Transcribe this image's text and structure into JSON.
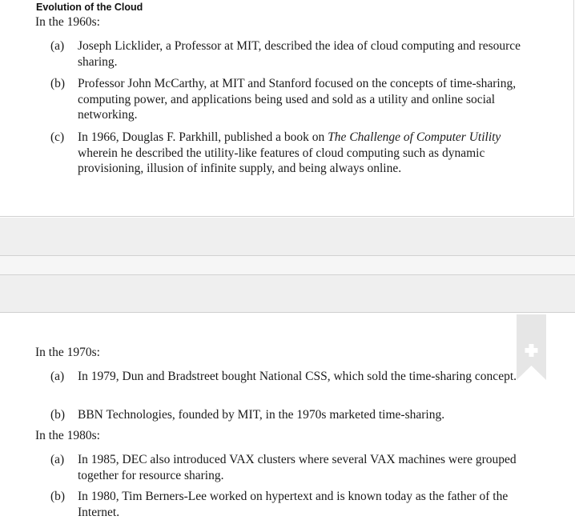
{
  "section_title": "Evolution of the Cloud",
  "era_1960s": {
    "heading": "In the 1960s:",
    "items": [
      {
        "label": "(a)",
        "text": "Joseph Licklider, a Professor at MIT, described the idea of cloud computing and resource sharing."
      },
      {
        "label": "(b)",
        "text": "Professor John McCarthy, at MIT and Stanford focused on the concepts of time-sharing, computing power, and applications being used and sold as a utility and online social networking."
      },
      {
        "label": "(c)",
        "text_before": "In 1966, Douglas F. Parkhill, published a book on ",
        "text_italic": "The Challenge of Computer Utility",
        "text_after": " wherein he described the utility-like features of cloud computing such as dynamic provisioning, illusion of infinite supply, and being always online."
      }
    ]
  },
  "era_1970s": {
    "heading": "In the 1970s:",
    "items": [
      {
        "label": "(a)",
        "text": "In 1979, Dun and Bradstreet bought National CSS, which sold the time-sharing concept."
      },
      {
        "label": "(b)",
        "text": "BBN Technologies, founded by MIT, in the 1970s marketed time-sharing."
      }
    ]
  },
  "era_1980s": {
    "heading": "In the 1980s:",
    "items": [
      {
        "label": "(a)",
        "text": "In 1985, DEC also introduced VAX clusters where several VAX machines were grouped together for resource sharing."
      },
      {
        "label": "(b)",
        "text": "In 1980, Tim Berners-Lee worked on hypertext and is known today as the father of the Internet."
      }
    ]
  },
  "bookmark": {
    "icon": "plus-icon",
    "color": "#e6e6e6"
  }
}
